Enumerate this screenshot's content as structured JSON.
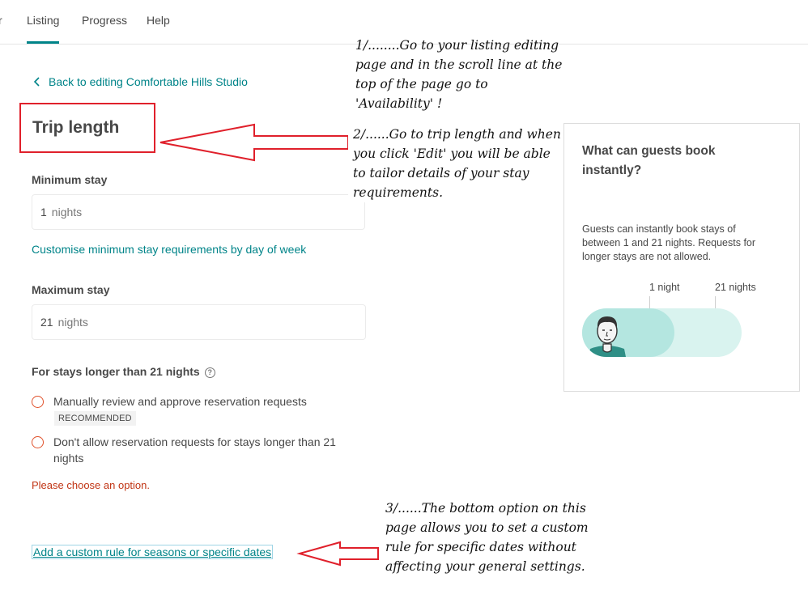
{
  "nav": {
    "items": [
      {
        "label": "r"
      },
      {
        "label": "Listing"
      },
      {
        "label": "Progress"
      },
      {
        "label": "Help"
      }
    ]
  },
  "back_link": "Back to editing Comfortable Hills Studio",
  "page_title": "Trip length",
  "minimum_stay": {
    "label": "Minimum stay",
    "value": "1",
    "unit": "nights"
  },
  "customise_link": "Customise minimum stay requirements by day of week",
  "maximum_stay": {
    "label": "Maximum stay",
    "value": "21",
    "unit": "nights"
  },
  "longer_stays": {
    "label": "For stays longer than 21 nights",
    "help_icon": "?",
    "options": [
      {
        "label": "Manually review and approve reservation requests",
        "badge": "RECOMMENDED"
      },
      {
        "label": "Don't allow reservation requests for stays longer than 21 nights"
      }
    ],
    "error": "Please choose an option."
  },
  "custom_rule_link": "Add a custom rule for seasons or specific dates",
  "annotations": {
    "step1": "1/........Go to your listing editing page and in the scroll line at the top of the page go to 'Availability' !",
    "step2": "2/......Go to trip length and when you click 'Edit' you will be able to tailor details of your stay requirements.",
    "step3": "3/......The bottom option on this page allows you to set a custom rule for specific dates without affecting your general settings."
  },
  "card": {
    "title": "What can guests book instantly?",
    "body": "Guests can instantly book stays of between 1 and 21 nights. Requests for longer stays are not allowed.",
    "min_label": "1 night",
    "max_label": "21 nights"
  },
  "colors": {
    "accent": "#008489",
    "annotation_red": "#e0202b",
    "error": "#c13515"
  }
}
